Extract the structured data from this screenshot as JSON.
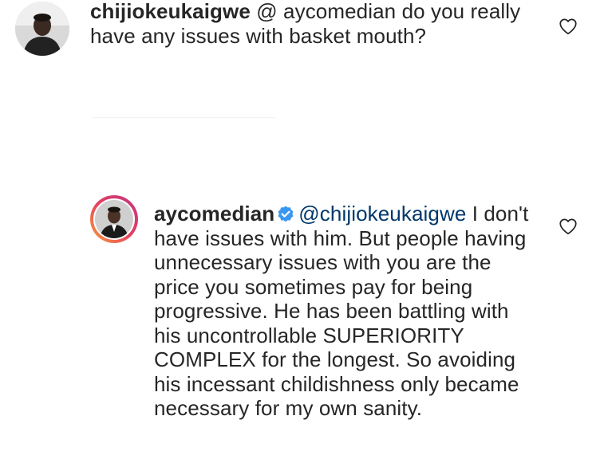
{
  "comments": [
    {
      "username": "chijiokeukaigwe",
      "text": " @ aycomedian do you really have any issues with basket mouth?",
      "icons": {
        "avatar": "user-avatar-photo",
        "like": "heart-outline-icon"
      }
    },
    {
      "username": "aycomedian",
      "verified": true,
      "mention": "@chijiokeukaigwe",
      "text": " I don't have issues  with  him. But people having unnecessary issues with you are the price you sometimes pay for being progressive. He has been battling with his uncontrollable SUPERIORITY COMPLEX for the longest. So avoiding his incessant childishness only became necessary for my own sanity.",
      "icons": {
        "avatar": "user-avatar-photo-story-ring",
        "verified": "verified-badge-icon",
        "like": "heart-outline-icon"
      }
    }
  ],
  "colors": {
    "text": "#262626",
    "mention": "#00376b",
    "verified": "#3897f0",
    "heart_stroke": "#262626"
  }
}
